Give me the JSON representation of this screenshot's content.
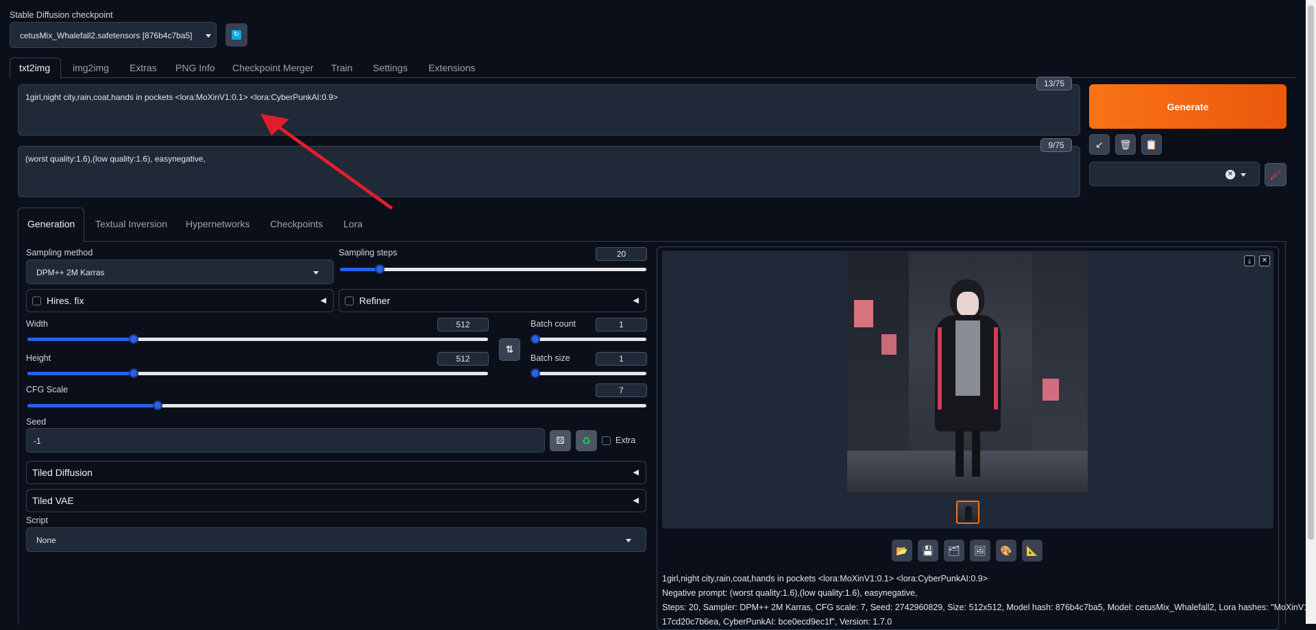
{
  "checkpoint": {
    "label": "Stable Diffusion checkpoint",
    "value": "cetusMix_Whalefall2.safetensors [876b4c7ba5]",
    "refresh_icon": "refresh-icon"
  },
  "main_tabs": [
    "txt2img",
    "img2img",
    "Extras",
    "PNG Info",
    "Checkpoint Merger",
    "Train",
    "Settings",
    "Extensions"
  ],
  "prompt": {
    "value": "1girl,night city,rain,coat,hands in pockets <lora:MoXinV1:0.1>  <lora:CyberPunkAI:0.9>",
    "token_count": "13/75"
  },
  "negative_prompt": {
    "value": "(worst quality:1.6),(low quality:1.6),  easynegative,",
    "token_count": "9/75"
  },
  "generate": {
    "label": "Generate",
    "color": "#f97316"
  },
  "tool_buttons": [
    "arrow-icon",
    "trash-icon",
    "clipboard-icon"
  ],
  "styles": {
    "value": "",
    "brush_icon": "brush-icon"
  },
  "sub_tabs": [
    "Generation",
    "Textual Inversion",
    "Hypernetworks",
    "Checkpoints",
    "Lora"
  ],
  "generation": {
    "sampling_method_label": "Sampling method",
    "sampling_method_value": "DPM++ 2M Karras",
    "sampling_steps_label": "Sampling steps",
    "sampling_steps_value": "20",
    "sampling_steps_fraction": 0.13,
    "hires_label": "Hires. fix",
    "refiner_label": "Refiner",
    "width_label": "Width",
    "width_value": "512",
    "width_fraction": 0.23,
    "height_label": "Height",
    "height_value": "512",
    "height_fraction": 0.23,
    "batch_count_label": "Batch count",
    "batch_count_value": "1",
    "batch_size_label": "Batch size",
    "batch_size_value": "1",
    "cfg_label": "CFG Scale",
    "cfg_value": "7",
    "cfg_fraction": 0.21,
    "seed_label": "Seed",
    "seed_value": "-1",
    "extra_label": "Extra",
    "tiled_diffusion_label": "Tiled Diffusion",
    "tiled_vae_label": "Tiled VAE",
    "script_label": "Script",
    "script_value": "None"
  },
  "output": {
    "action_icons": [
      "folder-icon",
      "save-icon",
      "zip-icon",
      "image-icon",
      "palette-icon",
      "ruler-icon"
    ],
    "info_prompt": "1girl,night city,rain,coat,hands in pockets <lora:MoXinV1:0.1> <lora:CyberPunkAI:0.9>",
    "info_negative": "Negative prompt: (worst quality:1.6),(low quality:1.6), easynegative,",
    "info_params_1": "Steps: 20, Sampler: DPM++ 2M Karras, CFG scale: 7, Seed: 2742960829, Size: 512x512, Model hash: 876b4c7ba5, Model: cetusMix_Whalefall2, Lora hashes: \"MoXinV1:",
    "info_params_2": "17cd20c7b6ea, CyberPunkAI: bce0ecd9ec1f\", Version: 1.7.0"
  },
  "annotation_color": "#e11d2a"
}
